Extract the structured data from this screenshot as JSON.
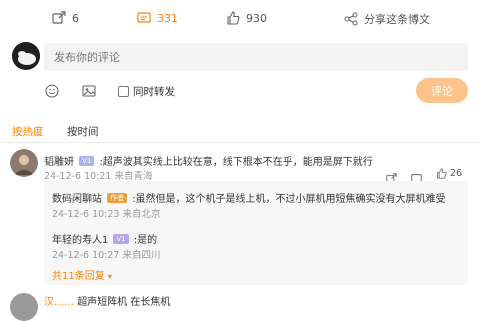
{
  "actions": {
    "repost_count": "6",
    "comment_count": "331",
    "like_count": "930",
    "share_label": "分享这条博文"
  },
  "composer": {
    "placeholder": "发布你的评论",
    "repost_checkbox_label": "同时转发",
    "submit_label": "评论"
  },
  "tabs": [
    {
      "label": "按热度",
      "active": true
    },
    {
      "label": "按时间",
      "active": false
    }
  ],
  "comments": [
    {
      "username": "韬雕妍",
      "badge": "V1",
      "text": ":超声波其实线上比较在意，线下根本不在乎，能用是屏下就行",
      "time": "24-12-6 10:21",
      "location": "来自青海",
      "like_count": "26",
      "replies": [
        {
          "username": "数码闲聊站",
          "badge": "作者",
          "text": ":虽然但是，这个机子是线上机，不过小屏机用短焦确实没有大屏机难受",
          "time": "24-12-6 10:23",
          "location": "来自北京"
        },
        {
          "username": "年轻的寿人1",
          "badge": "V1",
          "text": ":是的",
          "time": "24-12-6 10:27",
          "location": "来自四川"
        }
      ],
      "more_replies": "共11条回复"
    }
  ],
  "partial_next": {
    "username": "汉……",
    "text": "超声短阵机 在长焦机"
  },
  "colors": {
    "accent": "#ff8200",
    "button": "#fcc38c",
    "input_bg": "#f3f3f3"
  }
}
